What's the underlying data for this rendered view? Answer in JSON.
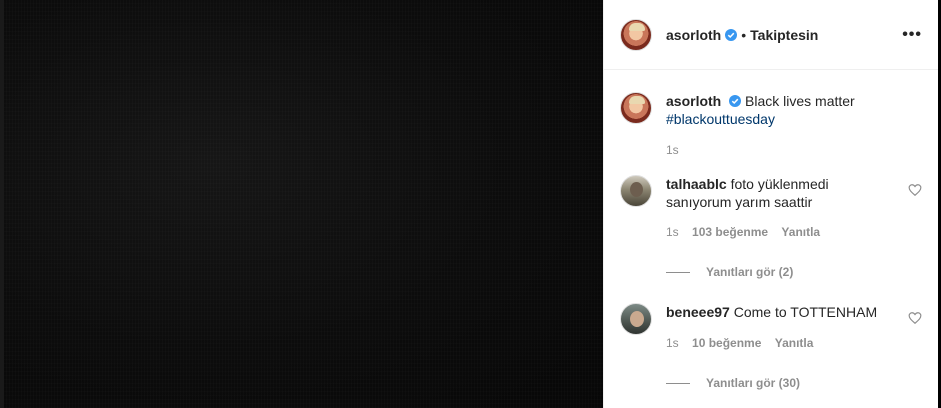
{
  "post": {
    "username": "asorloth",
    "follow_label": "Takiptesin",
    "separator": "•",
    "more_label": "•••"
  },
  "caption": {
    "username": "asorloth",
    "text": "Black lives matter",
    "hashtag": "#blackouttuesday",
    "time": "1s"
  },
  "comments": [
    {
      "username": "talhaablc",
      "text": "foto yüklenmedi sanıyorum yarım saattir",
      "time": "1s",
      "likes": "103 beğenme",
      "reply_label": "Yanıtla",
      "view_replies": "Yanıtları gör (2)"
    },
    {
      "username": "beneee97",
      "text": "Come to TOTTENHAM",
      "time": "1s",
      "likes": "10 beğenme",
      "reply_label": "Yanıtla",
      "view_replies": "Yanıtları gör (30)"
    }
  ],
  "colors": {
    "verified": "#3897f0",
    "hashtag": "#00376b",
    "secondary_text": "#8e8e8e"
  }
}
